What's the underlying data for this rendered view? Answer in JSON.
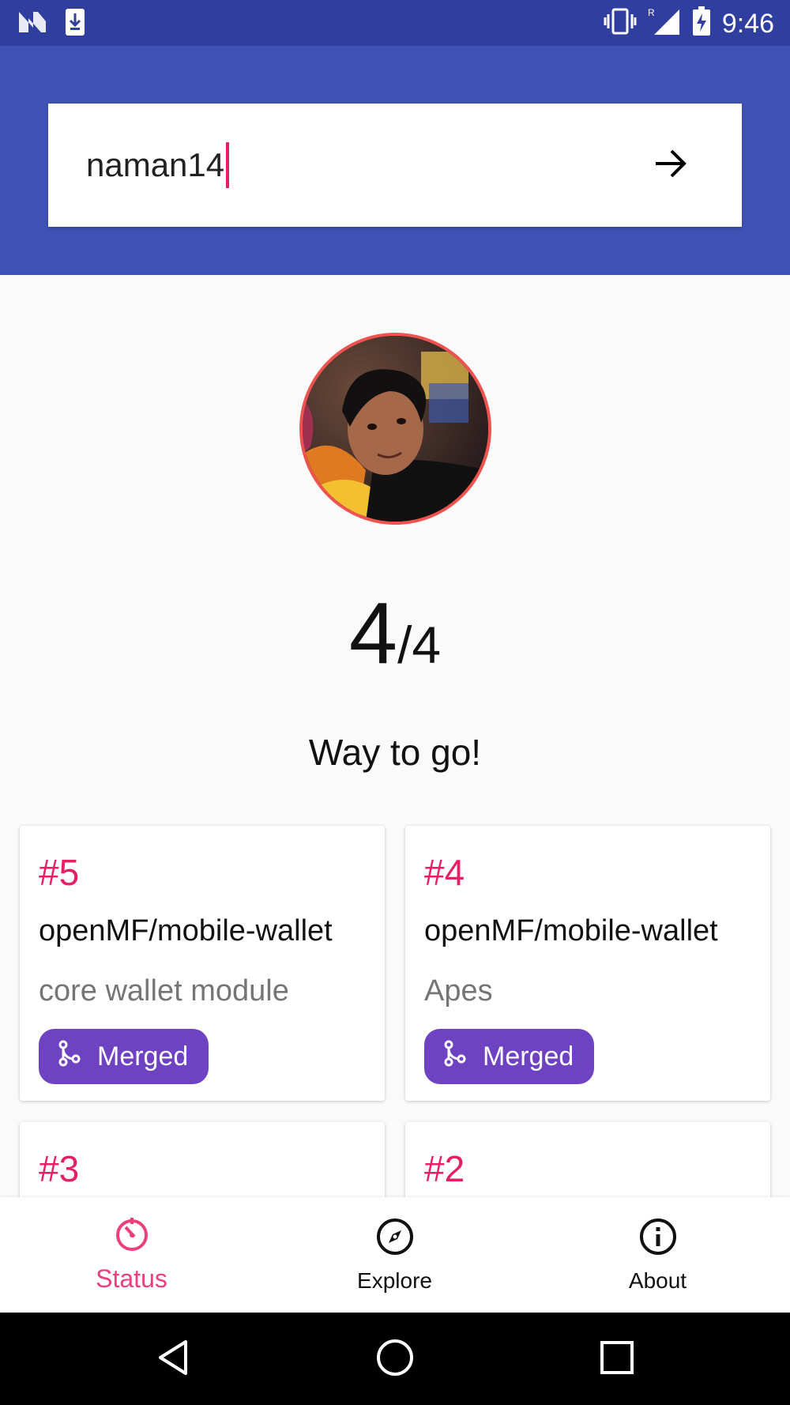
{
  "status_bar": {
    "time": "9:46",
    "left_icons": [
      "n-logo-icon",
      "download-icon"
    ],
    "right_icons": [
      "vibrate-icon",
      "signal-icon",
      "battery-charging-icon"
    ]
  },
  "search": {
    "value": "naman14",
    "go_icon": "arrow-right-icon"
  },
  "profile": {
    "score_done": "4",
    "score_total": "/4",
    "message": "Way to go!"
  },
  "cards": [
    {
      "number": "#5",
      "repo": "openMF/mobile-wallet",
      "title": "core wallet module",
      "status": "Merged"
    },
    {
      "number": "#4",
      "repo": "openMF/mobile-wallet",
      "title": "Apes",
      "status": "Merged"
    },
    {
      "number": "#3"
    },
    {
      "number": "#2"
    }
  ],
  "bottom_nav": {
    "items": [
      {
        "label": "Status",
        "icon": "status-timer-icon",
        "active": true
      },
      {
        "label": "Explore",
        "icon": "compass-icon",
        "active": false
      },
      {
        "label": "About",
        "icon": "info-icon",
        "active": false
      }
    ]
  },
  "colors": {
    "status_bar": "#303f9f",
    "app_bar": "#3f51b5",
    "accent": "#e91e63",
    "merged": "#6f42c1"
  }
}
